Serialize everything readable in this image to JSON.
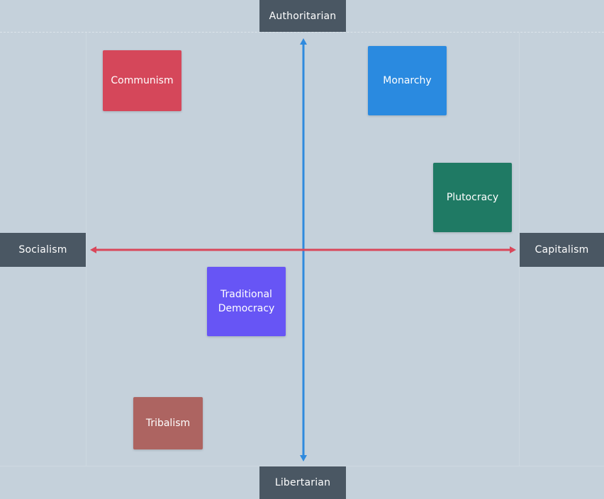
{
  "axes": {
    "top": "Authoritarian",
    "bottom": "Libertarian",
    "left": "Socialism",
    "right": "Capitalism",
    "vertical_color": "#2f8ade",
    "horizontal_color": "#d9475a"
  },
  "nodes": [
    {
      "id": "communism",
      "label": "Communism",
      "color": "#d5475a"
    },
    {
      "id": "monarchy",
      "label": "Monarchy",
      "color": "#2a8ae0"
    },
    {
      "id": "plutocracy",
      "label": "Plutocracy",
      "color": "#1f7a64"
    },
    {
      "id": "democracy",
      "label": "Traditional\nDemocracy",
      "color": "#6755f5"
    },
    {
      "id": "tribalism",
      "label": "Tribalism",
      "color": "#ad6461"
    }
  ]
}
